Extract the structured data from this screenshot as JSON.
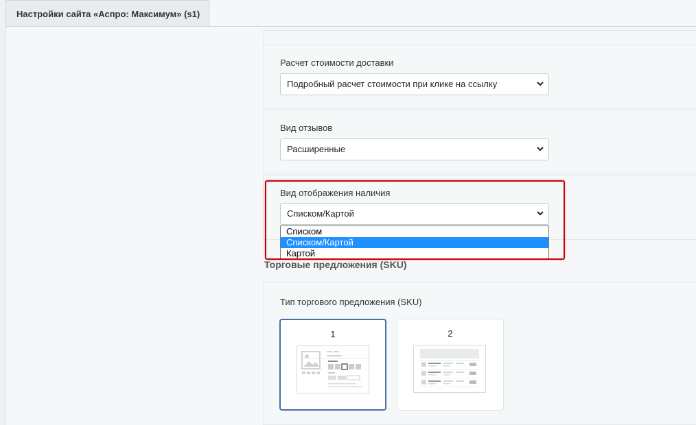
{
  "header": {
    "tab_title": "Настройки сайта «Аспро: Максимум» (s1)"
  },
  "fields": {
    "delivery": {
      "label": "Расчет стоимости доставки",
      "value": "Подробный расчет стоимости при клике на ссылку"
    },
    "reviews": {
      "label": "Вид отзывов",
      "value": "Расширенные"
    },
    "availability": {
      "label": "Вид отображения наличия",
      "value": "Списком/Картой",
      "options": [
        "Списком",
        "Списком/Картой",
        "Картой"
      ],
      "selected_index": 1
    }
  },
  "sku_section": {
    "title": "Торговые предложения (SKU)",
    "field_label": "Тип торгового предложения (SKU)",
    "options": [
      {
        "label": "1",
        "selected": true
      },
      {
        "label": "2",
        "selected": false
      }
    ]
  },
  "colors": {
    "highlight": "#cc0000",
    "selected_option": "#1e90ff",
    "active_card_border": "#4a6ea1"
  }
}
